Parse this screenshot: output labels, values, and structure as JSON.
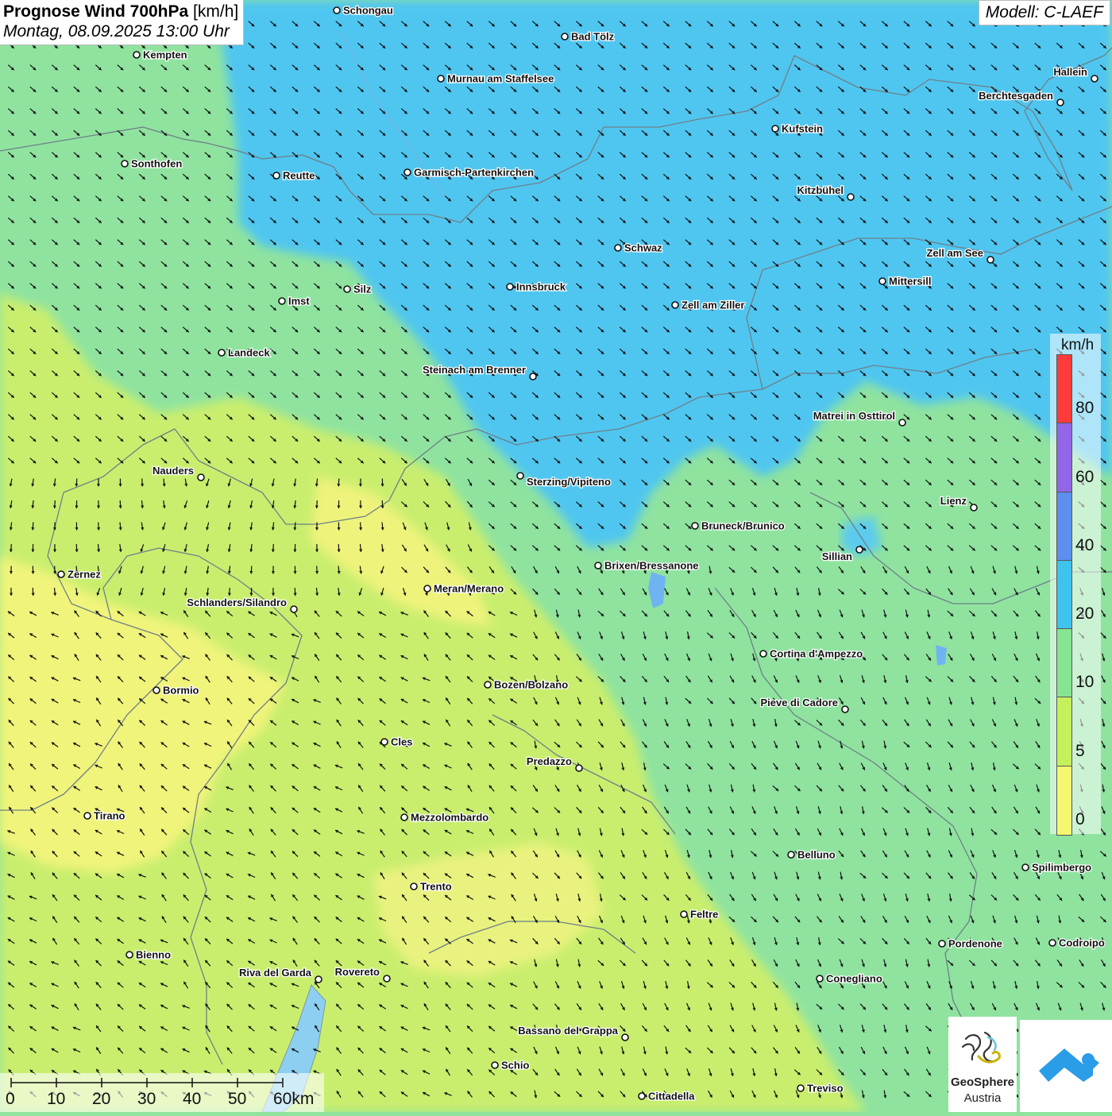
{
  "header": {
    "title_bold": "Prognose Wind 700hPa",
    "title_unit": "[km/h]",
    "datetime": "Montag, 08.09.2025 13:00 Uhr",
    "model": "Modell: C-LAEF"
  },
  "legend": {
    "unit": "km/h",
    "labels": [
      "80",
      "60",
      "40",
      "20",
      "10",
      "5",
      "0"
    ],
    "colors": [
      "#ff3a3a",
      "#9266e6",
      "#5c8fee",
      "#3ec3ee",
      "#86e591",
      "#c6ef5c",
      "#f5f771"
    ]
  },
  "scale_bar": {
    "labels": [
      "0",
      "10",
      "20",
      "30",
      "40",
      "50",
      "60km"
    ]
  },
  "logos": {
    "geosphere_line1": "GeoSphere",
    "geosphere_line2": "Austria"
  },
  "cities": [
    {
      "name": "Schongau"
    },
    {
      "name": "Bad Tölz"
    },
    {
      "name": "Kempten"
    },
    {
      "name": "Murnau am Staffelsee"
    },
    {
      "name": "Hallein"
    },
    {
      "name": "Berchtesgaden"
    },
    {
      "name": "Kufstein"
    },
    {
      "name": "Sonthofen"
    },
    {
      "name": "Reutte"
    },
    {
      "name": "Garmisch-Partenkirchen"
    },
    {
      "name": "Kitzbühel"
    },
    {
      "name": "Schwaz"
    },
    {
      "name": "Zell am See"
    },
    {
      "name": "Mittersill"
    },
    {
      "name": "Innsbruck"
    },
    {
      "name": "Silz"
    },
    {
      "name": "Imst"
    },
    {
      "name": "Zell am Ziller"
    },
    {
      "name": "Landeck"
    },
    {
      "name": "Steinach am Brenner"
    },
    {
      "name": "Matrei in Osttirol"
    },
    {
      "name": "Nauders"
    },
    {
      "name": "Sterzing/Vipiteno"
    },
    {
      "name": "Lienz"
    },
    {
      "name": "Bruneck/Brunico"
    },
    {
      "name": "Sillian"
    },
    {
      "name": "Brixen/Bressanone"
    },
    {
      "name": "Zernez"
    },
    {
      "name": "Meran/Merano"
    },
    {
      "name": "Schlanders/Silandro"
    },
    {
      "name": "Cortina d'Ampezzo"
    },
    {
      "name": "Bozen/Bolzano"
    },
    {
      "name": "Bormio"
    },
    {
      "name": "Pieve di Cadore"
    },
    {
      "name": "Cles"
    },
    {
      "name": "Predazzo"
    },
    {
      "name": "Tirano"
    },
    {
      "name": "Mezzolombardo"
    },
    {
      "name": "Belluno"
    },
    {
      "name": "Spilimbergo"
    },
    {
      "name": "Trento"
    },
    {
      "name": "Feltre"
    },
    {
      "name": "Pordenone"
    },
    {
      "name": "Codroipo"
    },
    {
      "name": "Bienno"
    },
    {
      "name": "Riva del Garda"
    },
    {
      "name": "Rovereto"
    },
    {
      "name": "Conegliano"
    },
    {
      "name": "Bassano del Grappa"
    },
    {
      "name": "Schio"
    },
    {
      "name": "Treviso"
    },
    {
      "name": "Cittadella"
    }
  ]
}
